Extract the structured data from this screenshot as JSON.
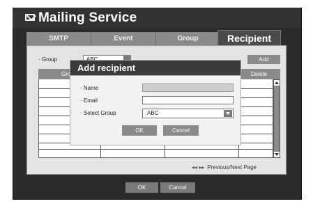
{
  "window": {
    "title": "Mailing Service",
    "icon": "mail-icon"
  },
  "tabs": [
    {
      "label": "SMTP"
    },
    {
      "label": "Event"
    },
    {
      "label": "Group"
    },
    {
      "label": "Recipient",
      "active": true
    }
  ],
  "filter": {
    "label": "· Group",
    "selected": "ABC"
  },
  "add_label": "Add",
  "table": {
    "headers": [
      "Gro",
      "Delete"
    ],
    "rows": 8
  },
  "pager": {
    "arrows": "◂◂ ▸▸",
    "label": "Previous/Next Page"
  },
  "footer": {
    "ok": "OK",
    "cancel": "Cancel"
  },
  "dialog": {
    "title": "Add recipient",
    "name_label": "· Name",
    "name_value": "",
    "email_label": "· Email",
    "email_value": "",
    "group_label": "· Select Group",
    "group_value": "ABC",
    "ok": "OK",
    "cancel": "Cancel"
  },
  "colors": {
    "frame": "#2b2b2b",
    "tab_inactive": "#8a8a8a",
    "tab_active": "#4a4a4a",
    "panel": "#e4e4e4",
    "button": "#7a7a7a"
  }
}
